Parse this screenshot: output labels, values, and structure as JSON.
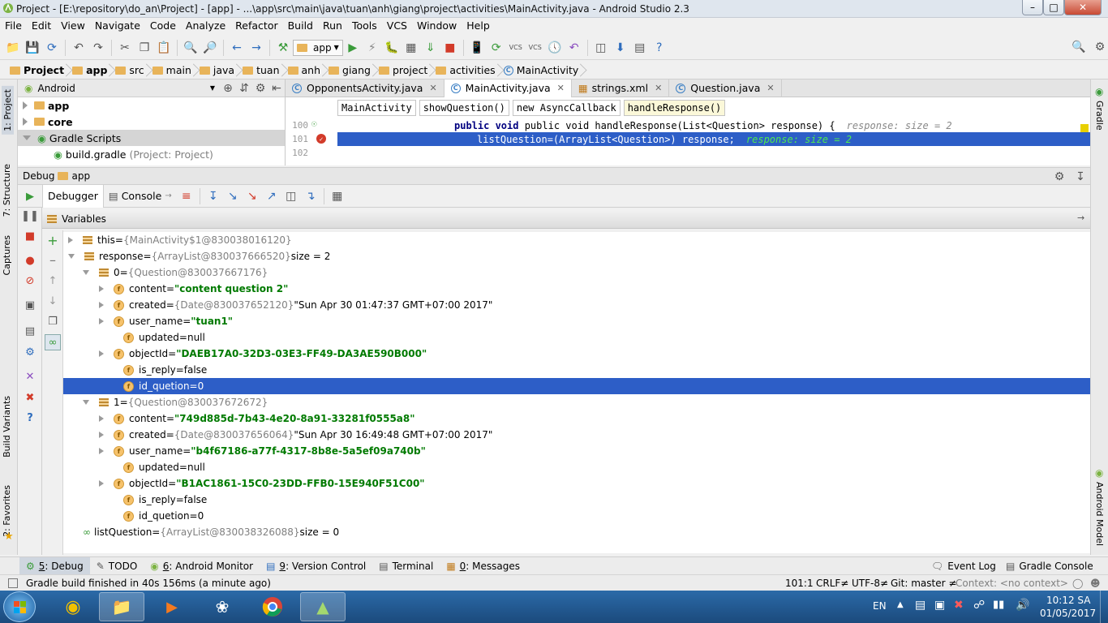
{
  "window": {
    "title": "Project - [E:\\repository\\do_an\\Project] - [app] - ...\\app\\src\\main\\java\\tuan\\anh\\giang\\project\\activities\\MainActivity.java - Android Studio 2.3"
  },
  "menu": [
    "File",
    "Edit",
    "View",
    "Navigate",
    "Code",
    "Analyze",
    "Refactor",
    "Build",
    "Run",
    "Tools",
    "VCS",
    "Window",
    "Help"
  ],
  "toolbar": {
    "run_config": "app"
  },
  "breadcrumb": [
    "Project",
    "app",
    "src",
    "main",
    "java",
    "tuan",
    "anh",
    "giang",
    "project",
    "activities",
    "MainActivity"
  ],
  "project_panel": {
    "view": "Android",
    "items": [
      {
        "label": "app",
        "expanded": false
      },
      {
        "label": "core",
        "expanded": false
      },
      {
        "label": "Gradle Scripts",
        "expanded": true
      },
      {
        "label": "build.gradle",
        "note": "(Project: Project)"
      }
    ]
  },
  "editor": {
    "tabs": [
      "OpponentsActivity.java",
      "MainActivity.java",
      "strings.xml",
      "Question.java"
    ],
    "active_tab": "MainActivity.java",
    "method_crumbs": [
      "MainActivity",
      "showQuestion()",
      "new AsyncCallback",
      "handleResponse()"
    ],
    "lines": [
      {
        "num": "100",
        "code": "public void handleResponse(List<Question> response) {",
        "hint": "response:  size = 2"
      },
      {
        "num": "101",
        "code": "listQuestion=(ArrayList<Question>) response;",
        "hint": "response:  size = 2"
      },
      {
        "num": "102",
        "code": "",
        "hint": ""
      }
    ]
  },
  "debug": {
    "title": "Debug",
    "config": "app",
    "tabs": [
      "Debugger",
      "Console"
    ],
    "variables_label": "Variables",
    "rows": [
      {
        "name": "this",
        "eq": " = ",
        "ref": "{MainActivity$1@830038016120}",
        "val": ""
      },
      {
        "name": "response",
        "eq": " = ",
        "ref": "{ArrayList@830037666520}",
        "val": " size = 2"
      },
      {
        "name": "0",
        "eq": " = ",
        "ref": "{Question@830037667176}",
        "val": ""
      },
      {
        "name": "content",
        "eq": " = ",
        "ref": "",
        "val": "\"content question 2\""
      },
      {
        "name": "created",
        "eq": " = ",
        "ref": "{Date@830037652120}",
        "val": " \"Sun Apr 30 01:47:37 GMT+07:00 2017\""
      },
      {
        "name": "user_name",
        "eq": " = ",
        "ref": "",
        "val": "\"tuan1\""
      },
      {
        "name": "updated",
        "eq": " = ",
        "ref": "",
        "val": "null"
      },
      {
        "name": "objectId",
        "eq": " = ",
        "ref": "",
        "val": "\"DAEB17A0-32D3-03E3-FF49-DA3AE590B000\""
      },
      {
        "name": "is_reply",
        "eq": " = ",
        "ref": "",
        "val": "false"
      },
      {
        "name": "id_quetion",
        "eq": " = ",
        "ref": "",
        "val": "0"
      },
      {
        "name": "1",
        "eq": " = ",
        "ref": "{Question@830037672672}",
        "val": ""
      },
      {
        "name": "content",
        "eq": " = ",
        "ref": "",
        "val": "\"749d885d-7b43-4e20-8a91-33281f0555a8\""
      },
      {
        "name": "created",
        "eq": " = ",
        "ref": "{Date@830037656064}",
        "val": " \"Sun Apr 30 16:49:48 GMT+07:00 2017\""
      },
      {
        "name": "user_name",
        "eq": " = ",
        "ref": "",
        "val": "\"b4f67186-a77f-4317-8b8e-5a5ef09a740b\""
      },
      {
        "name": "updated",
        "eq": " = ",
        "ref": "",
        "val": "null"
      },
      {
        "name": "objectId",
        "eq": " = ",
        "ref": "",
        "val": "\"B1AC1861-15C0-23DD-FFB0-15E940F51C00\""
      },
      {
        "name": "is_reply",
        "eq": " = ",
        "ref": "",
        "val": "false"
      },
      {
        "name": "id_quetion",
        "eq": " = ",
        "ref": "",
        "val": "0"
      },
      {
        "name": "listQuestion",
        "eq": " = ",
        "ref": "{ArrayList@830038326088}",
        "val": " size = 0"
      }
    ]
  },
  "left_stripe": [
    "1: Project",
    "7: Structure",
    "Captures",
    "Build Variants",
    "2: Favorites"
  ],
  "right_stripe": [
    "Gradle",
    "Android Model"
  ],
  "bottom_tabs": [
    {
      "key": "5",
      "label": ": Debug"
    },
    {
      "key": "",
      "label": "TODO"
    },
    {
      "key": "6",
      "label": ": Android Monitor"
    },
    {
      "key": "9",
      "label": ": Version Control"
    },
    {
      "key": "",
      "label": "Terminal"
    },
    {
      "key": "0",
      "label": ": Messages"
    }
  ],
  "bottom_right_tabs": [
    "Event Log",
    "Gradle Console"
  ],
  "status": {
    "message": "Gradle build finished in 40s 156ms (a minute ago)",
    "position": "101:1",
    "line_sep": "CRLF≠",
    "encoding": "UTF-8≠",
    "vcs": "Git: master ≠",
    "context": "Context: <no context>"
  },
  "taskbar": {
    "lang": "EN",
    "time": "10:12 SA",
    "date": "01/05/2017"
  },
  "colors": {
    "selection": "#2d5ec7",
    "string": "#007a00",
    "keyword": "#000080",
    "breakpoint": "#d23b2a"
  }
}
